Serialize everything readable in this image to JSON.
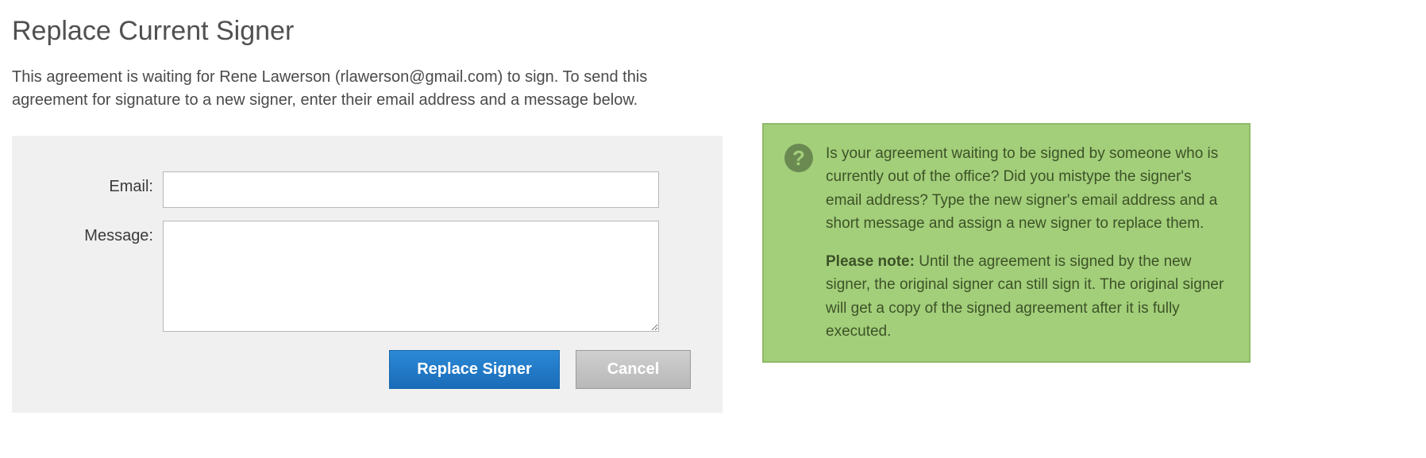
{
  "page": {
    "title": "Replace Current Signer",
    "description": "This agreement is waiting for Rene Lawerson (rlawerson@gmail.com) to sign. To send this agreement for signature to a new signer, enter their email address and a message below."
  },
  "form": {
    "email_label": "Email:",
    "email_value": "",
    "message_label": "Message:",
    "message_value": "",
    "submit_label": "Replace Signer",
    "cancel_label": "Cancel"
  },
  "info": {
    "paragraph1": "Is your agreement waiting to be signed by someone who is currently out of the office? Did you mistype the signer's email address? Type the new signer's email address and a short message and assign a new signer to replace them.",
    "note_label": "Please note:",
    "note_text": " Until the agreement is signed by the new signer, the original signer can still sign it. The original signer will get a copy of the signed agreement after it is fully executed."
  }
}
